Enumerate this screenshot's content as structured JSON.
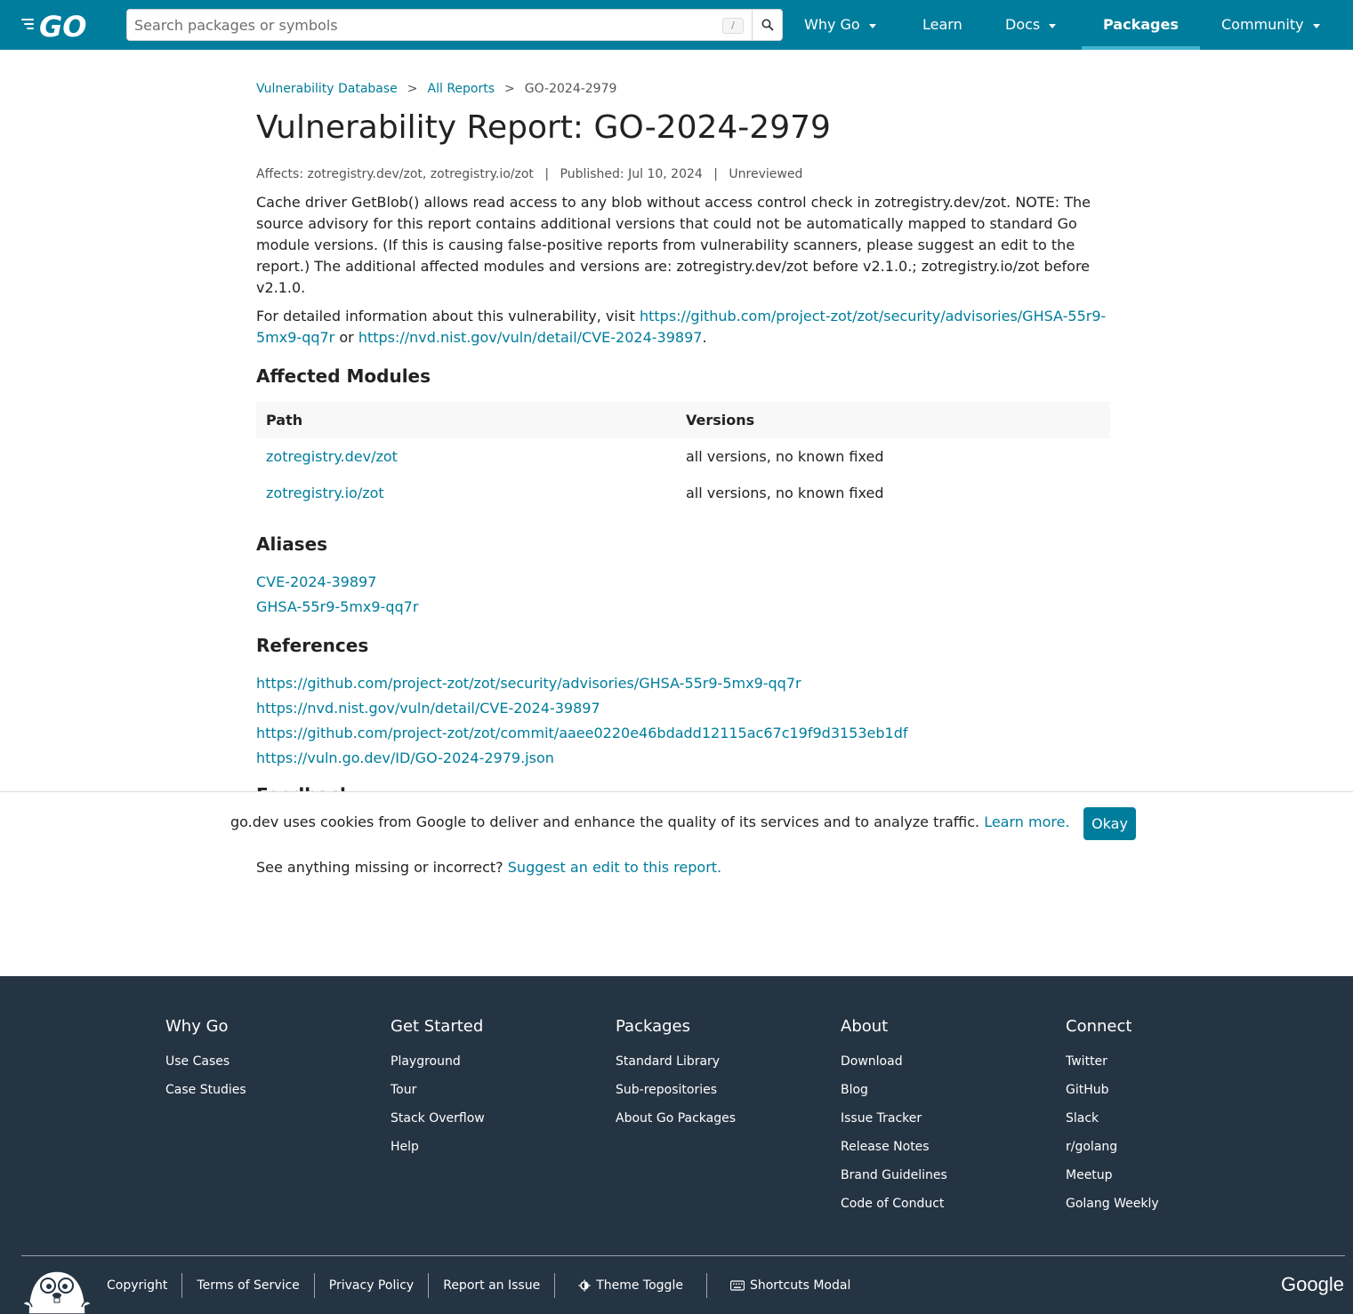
{
  "header": {
    "search_placeholder": "Search packages or symbols",
    "search_shortcut": "/",
    "nav": [
      {
        "label": "Why Go"
      },
      {
        "label": "Learn"
      },
      {
        "label": "Docs"
      },
      {
        "label": "Packages"
      },
      {
        "label": "Community"
      }
    ],
    "colors": {
      "header_bg": "#007d9c",
      "link": "#007d9c",
      "footer_bg": "#253443"
    }
  },
  "breadcrumb": {
    "items": [
      "Vulnerability Database",
      "All Reports",
      "GO-2024-2979"
    ],
    "separator": ">"
  },
  "report": {
    "title": "Vulnerability Report: GO-2024-2979",
    "affects": "Affects: zotregistry.dev/zot, zotregistry.io/zot",
    "published": "Published: Jul 10, 2024",
    "status": "Unreviewed",
    "meta_separator": "|",
    "description": "Cache driver GetBlob() allows read access to any blob without access control check in zotregistry.dev/zot. NOTE: The source advisory for this report contains additional versions that could not be automatically mapped to standard Go module versions. (If this is causing false-positive reports from vulnerability scanners, please suggest an edit to the report.) The additional affected modules and versions are: zotregistry.dev/zot before v2.1.0.; zotregistry.io/zot before v2.1.0.",
    "detail_prefix": "For detailed information about this vulnerability, visit ",
    "detail_link1": "https://github.com/project-zot/zot/security/advisories/GHSA-55r9-5mx9-qq7r",
    "detail_or": " or ",
    "detail_link2": "https://nvd.nist.gov/vuln/detail/CVE-2024-39897",
    "detail_suffix": "."
  },
  "affected": {
    "heading": "Affected Modules",
    "columns": [
      "Path",
      "Versions"
    ],
    "rows": [
      {
        "path": "zotregistry.dev/zot",
        "versions": "all versions, no known fixed"
      },
      {
        "path": "zotregistry.io/zot",
        "versions": "all versions, no known fixed"
      }
    ]
  },
  "aliases": {
    "heading": "Aliases",
    "items": [
      "CVE-2024-39897",
      "GHSA-55r9-5mx9-qq7r"
    ]
  },
  "references": {
    "heading": "References",
    "items": [
      "https://github.com/project-zot/zot/security/advisories/GHSA-55r9-5mx9-qq7r",
      "https://nvd.nist.gov/vuln/detail/CVE-2024-39897",
      "https://github.com/project-zot/zot/commit/aaee0220e46bdadd12115ac67c19f9d3153eb1df",
      "https://vuln.go.dev/ID/GO-2024-2979.json"
    ]
  },
  "feedback": {
    "heading": "Feedback",
    "prompt": "See anything missing or incorrect? ",
    "link": "Suggest an edit to this report."
  },
  "cookie": {
    "text": "go.dev uses cookies from Google to deliver and enhance the quality of its services and to analyze traffic. ",
    "learn_more": "Learn more.",
    "button": "Okay"
  },
  "footer": {
    "columns": [
      {
        "title": "Why Go",
        "items": [
          "Use Cases",
          "Case Studies"
        ]
      },
      {
        "title": "Get Started",
        "items": [
          "Playground",
          "Tour",
          "Stack Overflow",
          "Help"
        ]
      },
      {
        "title": "Packages",
        "items": [
          "Standard Library",
          "Sub-repositories",
          "About Go Packages"
        ]
      },
      {
        "title": "About",
        "items": [
          "Download",
          "Blog",
          "Issue Tracker",
          "Release Notes",
          "Brand Guidelines",
          "Code of Conduct"
        ]
      },
      {
        "title": "Connect",
        "items": [
          "Twitter",
          "GitHub",
          "Slack",
          "r/golang",
          "Meetup",
          "Golang Weekly"
        ]
      }
    ],
    "bottom_links": [
      "Copyright",
      "Terms of Service",
      "Privacy Policy",
      "Report an Issue",
      "Theme Toggle",
      "Shortcuts Modal"
    ],
    "brand": "Google"
  }
}
